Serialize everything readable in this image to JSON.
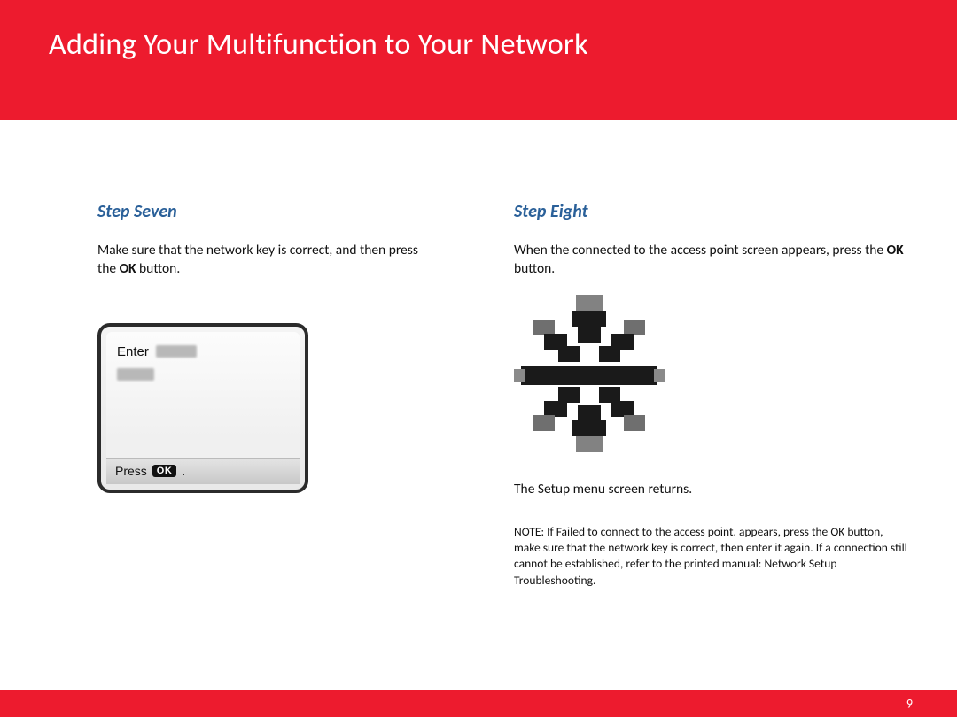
{
  "header": {
    "title": "Adding Your Multifunction to Your Network"
  },
  "stepSeven": {
    "heading": "Step Seven",
    "body_pre": "Make sure that the network key is correct, and then press the ",
    "body_bold1": "OK",
    "body_post": " button.",
    "screen": {
      "enter_label": "Enter",
      "press_label": "Press",
      "ok_badge": "OK",
      "dot": "."
    }
  },
  "stepEight": {
    "heading": "Step Eight",
    "body_pre": "When the connected to the access point  screen appears, press the ",
    "body_bold1": "OK",
    "body_post": " button.",
    "return_pre": "The ",
    "return_bold": "Setup menu",
    "return_post": "  screen returns.",
    "note": {
      "note_bold": "NOTE:",
      "p1a": "  If  ",
      "fail_bold": "Failed to connect to the access point",
      "p1b": ". appears, press the ",
      "ok_bold": "OK",
      "p1c": " button, make sure that the network key is correct, then enter it again. If a connection still cannot be established, refer to the printed manual: ",
      "tshoot_bold": "Network Setup Troubleshooting",
      "p1d": "."
    }
  },
  "footer": {
    "page_number": "9"
  }
}
